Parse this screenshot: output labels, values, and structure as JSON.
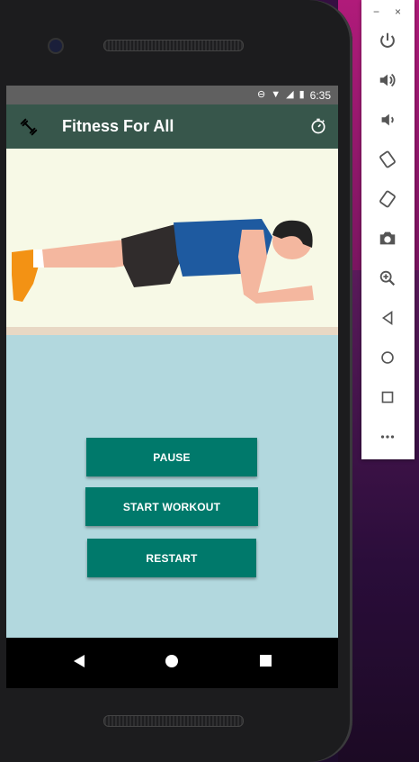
{
  "status_bar": {
    "time": "6:35"
  },
  "app_bar": {
    "title": "Fitness For All",
    "nav_icon": "dumbbell-icon",
    "action_icon": "timer-icon"
  },
  "illustration": {
    "subject": "plank-exercise-illustration"
  },
  "buttons": {
    "pause": "PAUSE",
    "start_workout": "START WORKOUT",
    "restart": "RESTART"
  },
  "colors": {
    "app_bar": "#37564b",
    "button": "#00796b",
    "content_bg": "#b2d8de",
    "illustration_bg": "#f7f9e6"
  },
  "emulator_toolbar": {
    "window_controls": [
      "−",
      "×"
    ],
    "items": [
      "power-icon",
      "volume-up-icon",
      "volume-down-icon",
      "rotate-left-icon",
      "rotate-right-icon",
      "screenshot-icon",
      "zoom-icon",
      "back-icon",
      "home-icon",
      "overview-icon",
      "more-icon"
    ]
  }
}
